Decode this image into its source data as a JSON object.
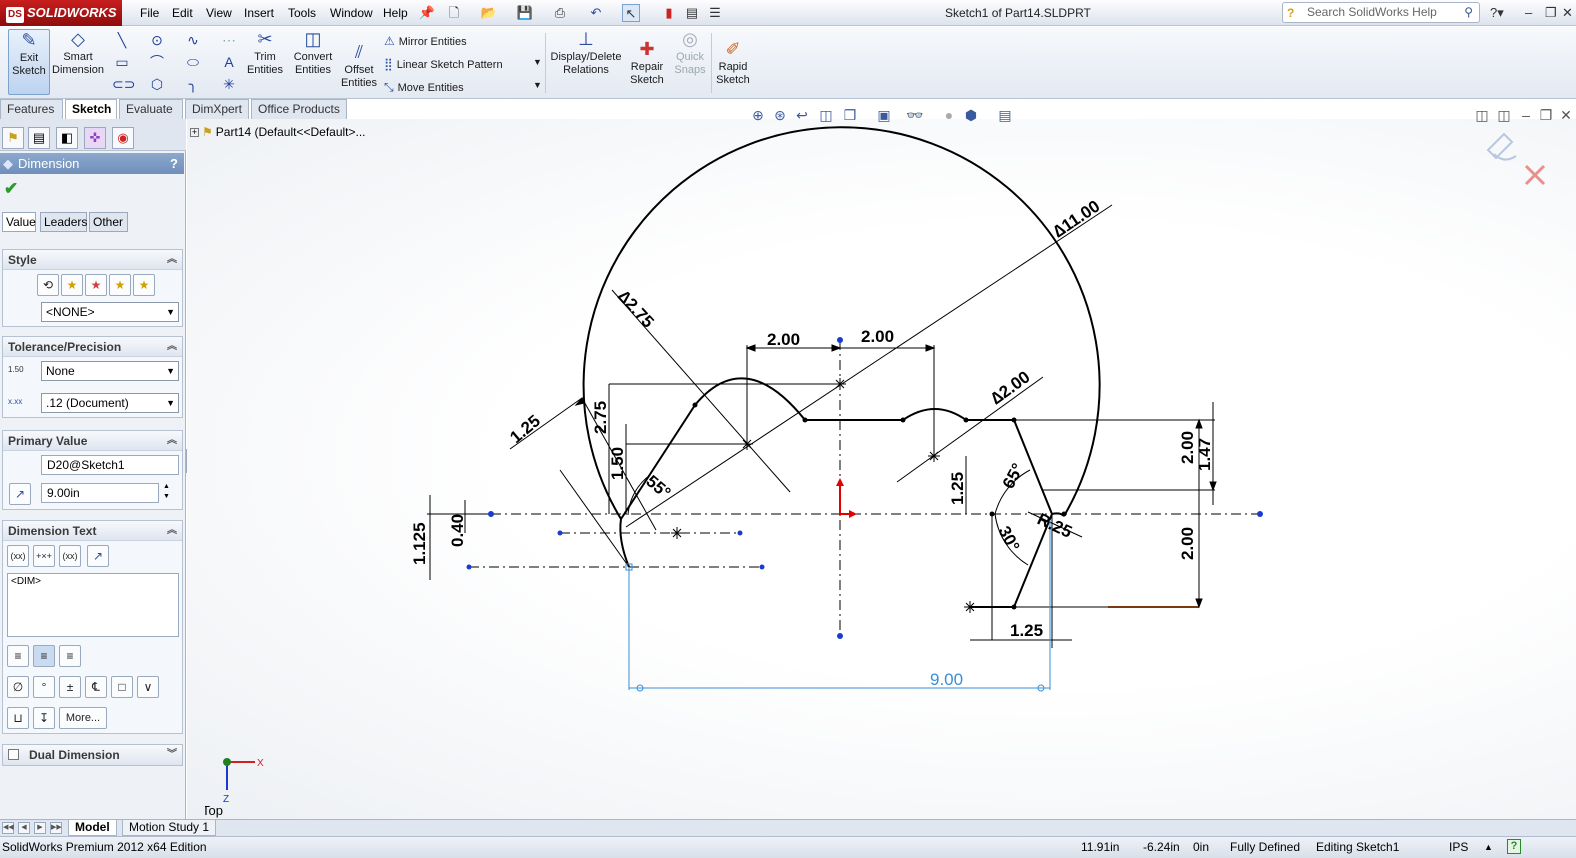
{
  "app": {
    "brand": "SOLIDWORKS",
    "brand_mark": "DS",
    "document_title": "Sketch1 of Part14.SLDPRT",
    "search_placeholder": "Search SolidWorks Help"
  },
  "menu": [
    "File",
    "Edit",
    "View",
    "Insert",
    "Tools",
    "Window",
    "Help"
  ],
  "command_manager": {
    "exit_sketch": "Exit Sketch",
    "smart_dimension": "Smart Dimension",
    "trim_entities": "Trim Entities",
    "convert_entities": "Convert Entities",
    "offset_entities": "Offset Entities",
    "mirror_entities": "Mirror Entities",
    "linear_sketch_pattern": "Linear Sketch Pattern",
    "move_entities": "Move Entities",
    "display_delete_relations": "Display/Delete Relations",
    "repair_sketch": "Repair Sketch",
    "quick_snaps": "Quick Snaps",
    "rapid_sketch": "Rapid Sketch"
  },
  "tabs": [
    "Features",
    "Sketch",
    "Evaluate",
    "DimXpert",
    "Office Products"
  ],
  "active_tab": "Sketch",
  "property_manager": {
    "title": "Dimension",
    "help": "?",
    "subtabs": [
      "Value",
      "Leaders",
      "Other"
    ],
    "style": {
      "heading": "Style",
      "selected": "<NONE>"
    },
    "tolerance": {
      "heading": "Tolerance/Precision",
      "type": "None",
      "precision": ".12 (Document)",
      "tol_icon_label": "1.50",
      "prec_icon_label": "x.xx"
    },
    "primary_value": {
      "heading": "Primary Value",
      "name": "D20@Sketch1",
      "value": "9.00in"
    },
    "dimension_text": {
      "heading": "Dimension Text",
      "text": "<DIM>",
      "more_button": "More..."
    },
    "dual_dimension": {
      "heading": "Dual Dimension"
    }
  },
  "feature_tree": {
    "root": "Part14  (Default<<Default>..."
  },
  "sketch_dimensions": {
    "d_large": "∆11.00",
    "d_hole_left": "∆2.75",
    "d_hole_right": "∆2.00",
    "top_left": "2.00",
    "top_right": "2.00",
    "r_small": "R.25",
    "angle_55": "55°",
    "angle_65": "65°",
    "angle_30": "30°",
    "left_125": "1.25",
    "left_275": "2.75",
    "left_150": "1.50",
    "left_040": "0.40",
    "left_1125": "1.125",
    "mid_125": "1.25",
    "right_200_top": "2.00",
    "right_147": "1.47",
    "right_200_bottom": "2.00",
    "bottom_125": "1.25",
    "driven_900": "9.00"
  },
  "view": {
    "orientation": "*Top",
    "axis_x": "X",
    "axis_z": "Z"
  },
  "bottom_tabs": [
    "Model",
    "Motion Study 1"
  ],
  "active_bottom_tab": "Model",
  "status": {
    "edition": "SolidWorks Premium 2012 x64 Edition",
    "x": "11.91in",
    "y": "-6.24in",
    "z": "0in",
    "state": "Fully Defined",
    "mode": "Editing Sketch1",
    "units": "IPS"
  },
  "colors": {
    "brand_red": "#b01010",
    "selected_dim_blue": "#3a8fd8",
    "sketch_black": "#000000",
    "origin_red": "#e00000",
    "pm_header": "#7893bf"
  }
}
